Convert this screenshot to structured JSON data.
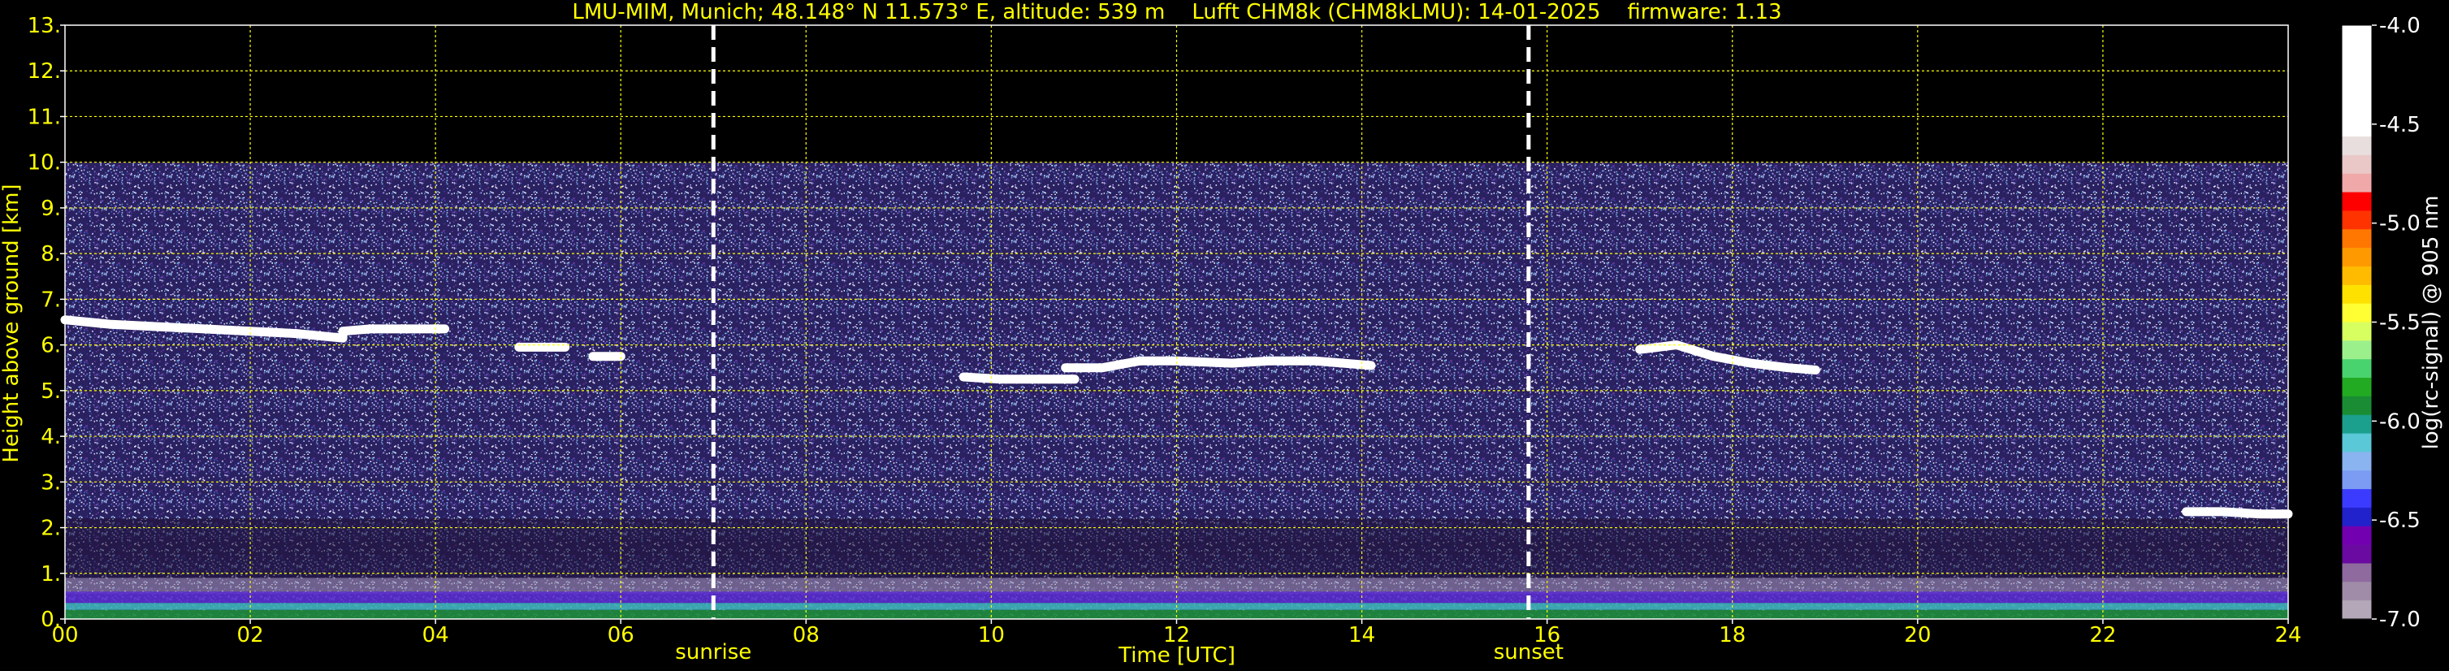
{
  "chart_data": {
    "type": "heatmap",
    "title": "LMU-MIM, Munich; 48.148° N 11.573° E, altitude: 539 m    Lufft CHM8k (CHM8kLMU): 14-01-2025    firmware: 1.13",
    "xlabel": "Time [UTC]",
    "ylabel": "Height above ground [km]",
    "xlim": [
      0,
      24
    ],
    "ylim": [
      0,
      13
    ],
    "x_ticks": [
      0,
      2,
      4,
      6,
      8,
      10,
      12,
      14,
      16,
      18,
      20,
      22,
      24
    ],
    "x_tick_labels": [
      "00",
      "02",
      "04",
      "06",
      "08",
      "10",
      "12",
      "14",
      "16",
      "18",
      "20",
      "22",
      "24"
    ],
    "y_ticks": [
      0,
      1,
      2,
      3,
      4,
      5,
      6,
      7,
      8,
      9,
      10,
      11,
      12,
      13
    ],
    "y_tick_labels": [
      "0.",
      "1.",
      "2.",
      "3.",
      "4.",
      "5.",
      "6.",
      "7.",
      "8.",
      "9.",
      "10.",
      "11.",
      "12.",
      "13."
    ],
    "grid": true,
    "measurement_top_km": 10,
    "sun_events": [
      {
        "label": "sunrise",
        "time": 7.0
      },
      {
        "label": "sunset",
        "time": 15.8
      }
    ],
    "cloud_layers": [
      {
        "time": [
          0.0,
          0.5,
          1.0,
          1.5,
          2.0,
          2.5,
          3.0,
          3.0,
          3.3,
          3.7,
          4.1
        ],
        "height": [
          6.55,
          6.45,
          6.4,
          6.35,
          6.3,
          6.25,
          6.15,
          6.3,
          6.35,
          6.35,
          6.35
        ]
      },
      {
        "time": [
          4.9,
          5.4
        ],
        "height": [
          5.95,
          5.95
        ]
      },
      {
        "time": [
          5.7,
          6.0
        ],
        "height": [
          5.75,
          5.75
        ]
      },
      {
        "time": [
          9.7,
          10.1,
          10.6,
          10.9
        ],
        "height": [
          5.3,
          5.25,
          5.25,
          5.25
        ]
      },
      {
        "time": [
          10.8,
          11.2,
          11.6,
          12.0,
          12.6,
          13.0,
          13.5,
          14.1
        ],
        "height": [
          5.5,
          5.5,
          5.65,
          5.65,
          5.6,
          5.65,
          5.65,
          5.55
        ]
      },
      {
        "time": [
          17.0,
          17.4,
          17.8,
          18.2,
          18.6,
          18.9
        ],
        "height": [
          5.9,
          6.0,
          5.75,
          5.6,
          5.5,
          5.45
        ]
      },
      {
        "time": [
          22.9,
          23.3,
          23.7,
          24.0
        ],
        "height": [
          2.35,
          2.35,
          2.3,
          2.3
        ]
      }
    ],
    "colorbar": {
      "label": "log(rc-signal) @ 905 nm",
      "min": -7.0,
      "max": -4.0,
      "ticks": [
        -4.0,
        -4.5,
        -5.0,
        -5.5,
        -6.0,
        -6.5,
        -7.0
      ],
      "tick_labels": [
        "-4.0",
        "-4.5",
        "-5.0",
        "-5.5",
        "-6.0",
        "-6.5",
        "-7.0"
      ],
      "colors": [
        "#ffffff",
        "#ffffff",
        "#ffffff",
        "#ffffff",
        "#ffffff",
        "#ffffff",
        "#e8dede",
        "#eac8c8",
        "#f0a8a8",
        "#ff0000",
        "#ff3300",
        "#ff7700",
        "#ff9900",
        "#ffbb00",
        "#ffe100",
        "#ffff33",
        "#d8ff60",
        "#9cf08c",
        "#49d36e",
        "#22aa22",
        "#1a8c33",
        "#1aa08c",
        "#5bc8d8",
        "#8ab4f0",
        "#7b9cf2",
        "#3b3bff",
        "#2222cc",
        "#7300b0",
        "#6a0aa0",
        "#8e6a9e",
        "#a08ca8",
        "#b4a8b8"
      ]
    }
  }
}
